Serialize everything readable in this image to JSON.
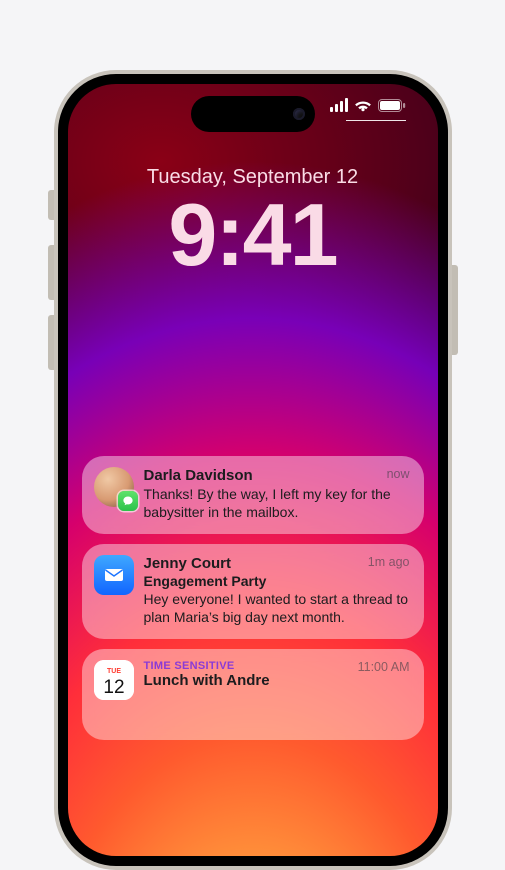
{
  "status": {
    "date": "Tuesday, September 12",
    "time": "9:41"
  },
  "notifications": [
    {
      "app": "messages",
      "sender": "Darla Davidson",
      "body": "Thanks! By the way, I left my key for the babysitter in the mailbox.",
      "timestamp": "now"
    },
    {
      "app": "mail",
      "sender": "Jenny Court",
      "subject": "Engagement Party",
      "body": "Hey everyone! I wanted to start a thread to plan Maria’s big day next month.",
      "timestamp": "1m ago"
    },
    {
      "app": "calendar",
      "tag": "TIME SENSITIVE",
      "title": "Lunch with Andre",
      "timestamp": "11:00 AM"
    }
  ],
  "colors": {
    "time_tint": "#fadbe6",
    "tag_purple": "#8a3bd6"
  }
}
